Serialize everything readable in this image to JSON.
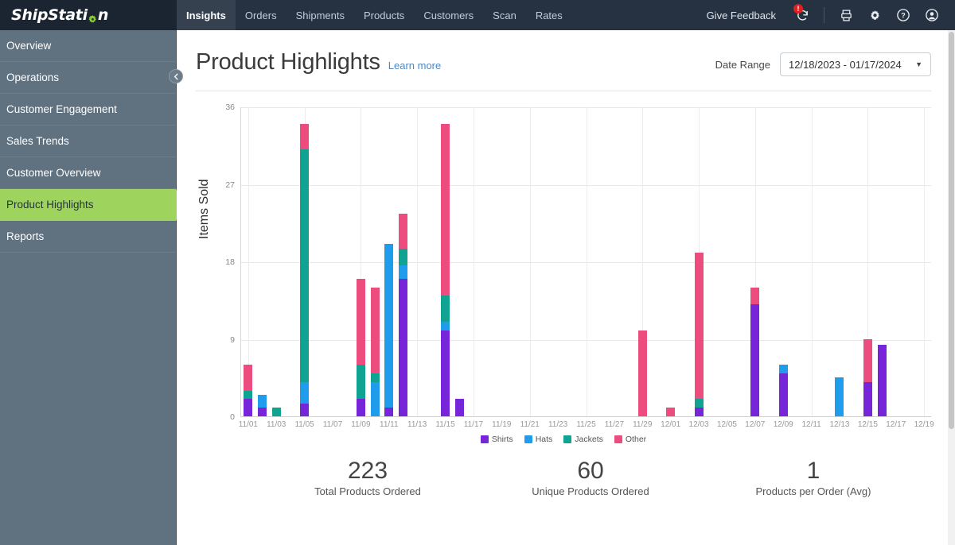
{
  "topnav": {
    "brand_pre": "ShipStati",
    "brand_post": "n",
    "gear_icon": "gear-icon",
    "tabs": [
      {
        "label": "Insights",
        "active": true
      },
      {
        "label": "Orders",
        "active": false
      },
      {
        "label": "Shipments",
        "active": false
      },
      {
        "label": "Products",
        "active": false
      },
      {
        "label": "Customers",
        "active": false
      },
      {
        "label": "Scan",
        "active": false
      },
      {
        "label": "Rates",
        "active": false
      }
    ],
    "feedback_label": "Give Feedback",
    "refresh_badge": "!",
    "icons": [
      "refresh-icon",
      "printer-icon",
      "gear-icon",
      "help-icon",
      "account-icon"
    ]
  },
  "sidebar": {
    "items": [
      {
        "label": "Overview",
        "active": false
      },
      {
        "label": "Operations",
        "active": false
      },
      {
        "label": "Customer Engagement",
        "active": false
      },
      {
        "label": "Sales Trends",
        "active": false
      },
      {
        "label": "Customer Overview",
        "active": false
      },
      {
        "label": "Product Highlights",
        "active": true
      },
      {
        "label": "Reports",
        "active": false
      }
    ],
    "collapse_icon": "chevron-left-icon"
  },
  "main": {
    "title": "Product Highlights",
    "learn_more": "Learn more",
    "date_range_label": "Date Range",
    "date_range_value": "12/18/2023 - 01/17/2024",
    "caret_icon": "chevron-down-icon"
  },
  "stats": [
    {
      "value": "223",
      "label": "Total Products Ordered"
    },
    {
      "value": "60",
      "label": "Unique Products Ordered"
    },
    {
      "value": "1",
      "label": "Products per Order (Avg)"
    }
  ],
  "colors": {
    "shirts": "#7625d8",
    "hats": "#1f9ceb",
    "jackets": "#10a391",
    "other": "#ec4d7e",
    "accent_green": "#9ed45d",
    "nav_dark": "#263241",
    "sidebar": "#60717f",
    "link_blue": "#4a89c7"
  },
  "chart_data": {
    "type": "bar",
    "stacked": true,
    "title": "",
    "xlabel": "",
    "ylabel": "Items Sold",
    "ylim": [
      0,
      36
    ],
    "yticks": [
      0,
      9,
      18,
      27,
      36
    ],
    "grid": true,
    "legend_position": "bottom",
    "series": [
      {
        "name": "Shirts",
        "color": "#7625d8"
      },
      {
        "name": "Hats",
        "color": "#1f9ceb"
      },
      {
        "name": "Jackets",
        "color": "#10a391"
      },
      {
        "name": "Other",
        "color": "#ec4d7e"
      }
    ],
    "xtick_labels": [
      "11/01",
      "11/03",
      "11/05",
      "11/07",
      "11/09",
      "11/11",
      "11/13",
      "11/15",
      "11/17",
      "11/19",
      "11/21",
      "11/23",
      "11/25",
      "11/27",
      "11/29",
      "12/01",
      "12/03",
      "12/05",
      "12/07",
      "12/09",
      "12/11",
      "12/13",
      "12/15",
      "12/17",
      "12/19"
    ],
    "x_start": "11/01",
    "x_end": "12/19",
    "bars": [
      {
        "date": "11/01",
        "day_index": 0,
        "Shirts": 2.0,
        "Hats": 0,
        "Jackets": 1.0,
        "Other": 3.0
      },
      {
        "date": "11/02",
        "day_index": 1,
        "Shirts": 1.0,
        "Hats": 1.5,
        "Jackets": 0,
        "Other": 0
      },
      {
        "date": "11/03",
        "day_index": 2,
        "Shirts": 0,
        "Hats": 0,
        "Jackets": 1.0,
        "Other": 0
      },
      {
        "date": "11/05",
        "day_index": 4,
        "Shirts": 1.5,
        "Hats": 2.5,
        "Jackets": 27.0,
        "Other": 3.0
      },
      {
        "date": "11/09",
        "day_index": 8,
        "Shirts": 2.0,
        "Hats": 0,
        "Jackets": 4.0,
        "Other": 10.0
      },
      {
        "date": "11/10",
        "day_index": 9,
        "Shirts": 0,
        "Hats": 4.0,
        "Jackets": 1.0,
        "Other": 10.0
      },
      {
        "date": "11/11",
        "day_index": 10,
        "Shirts": 1.0,
        "Hats": 19.0,
        "Jackets": 0,
        "Other": 0
      },
      {
        "date": "11/12",
        "day_index": 11,
        "Shirts": 16.0,
        "Hats": 1.5,
        "Jackets": 2.0,
        "Other": 4.0
      },
      {
        "date": "11/15",
        "day_index": 14,
        "Shirts": 10.0,
        "Hats": 1.0,
        "Jackets": 3.0,
        "Other": 20.0
      },
      {
        "date": "11/16",
        "day_index": 15,
        "Shirts": 2.0,
        "Hats": 0,
        "Jackets": 0,
        "Other": 0
      },
      {
        "date": "11/29",
        "day_index": 28,
        "Shirts": 0,
        "Hats": 0,
        "Jackets": 0,
        "Other": 10.0
      },
      {
        "date": "12/01",
        "day_index": 30,
        "Shirts": 0,
        "Hats": 0,
        "Jackets": 0,
        "Other": 1.0
      },
      {
        "date": "12/03",
        "day_index": 32,
        "Shirts": 1.0,
        "Hats": 0,
        "Jackets": 1.0,
        "Other": 17.0
      },
      {
        "date": "12/07",
        "day_index": 36,
        "Shirts": 13.0,
        "Hats": 0,
        "Jackets": 0,
        "Other": 2.0
      },
      {
        "date": "12/09",
        "day_index": 38,
        "Shirts": 5.0,
        "Hats": 1.0,
        "Jackets": 0,
        "Other": 0
      },
      {
        "date": "12/13",
        "day_index": 42,
        "Shirts": 0,
        "Hats": 4.5,
        "Jackets": 0,
        "Other": 0
      },
      {
        "date": "12/15",
        "day_index": 44,
        "Shirts": 4.0,
        "Hats": 0,
        "Jackets": 0,
        "Other": 5.0
      },
      {
        "date": "12/16",
        "day_index": 45,
        "Shirts": 8.3,
        "Hats": 0,
        "Jackets": 0,
        "Other": 0
      }
    ]
  }
}
